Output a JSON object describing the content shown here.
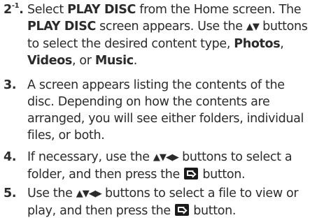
{
  "steps": [
    {
      "number": "2",
      "number_sup": "-1",
      "number_suffix": ".",
      "parts": {
        "t1": "Select ",
        "k1": "PLAY DISC",
        "t2": " from the Home screen. The ",
        "k2": "PLAY DISC",
        "t3": " screen appears. Use the ",
        "arrows": "▲▼",
        "t4": " buttons to select the desired content type, ",
        "k3": "Photos",
        "t5": ", ",
        "k4": "Videos",
        "t6": ", or ",
        "k5": "Music",
        "t7": "."
      }
    },
    {
      "number": "3.",
      "parts": {
        "t1": "A screen appears listing the contents of the disc. Depending on how the contents are arranged, you will see either folders, individual files, or both."
      }
    },
    {
      "number": "4.",
      "parts": {
        "t1": "If necessary, use the ",
        "arrows": "▲▼◀▶",
        "t2": " buttons to select a folder, and then press the ",
        "t3": " button."
      }
    },
    {
      "number": "5.",
      "parts": {
        "t1": "Use the ",
        "arrows": "▲▼◀▶",
        "t2": " buttons to select a file to view or play, and then press the ",
        "t3": " button."
      }
    }
  ],
  "icons": {
    "enter_button": "enter-button-icon"
  }
}
